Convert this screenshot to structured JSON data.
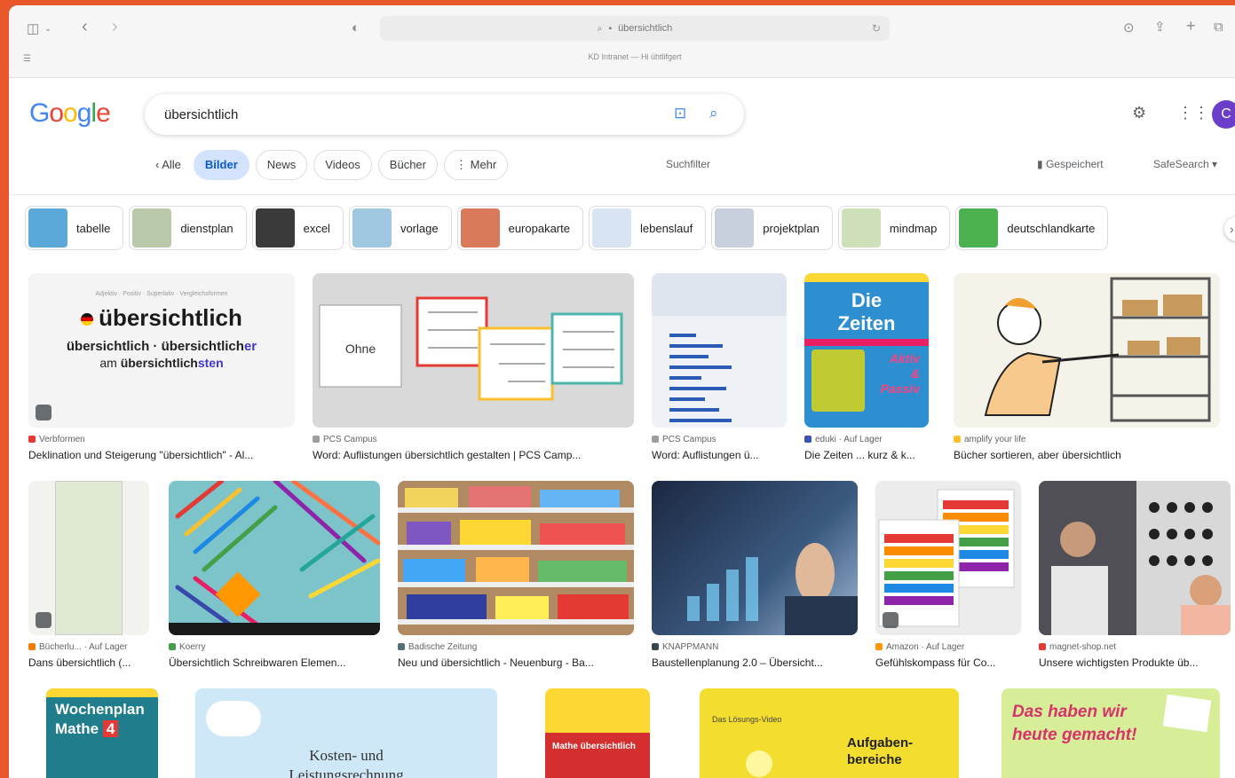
{
  "browser": {
    "url_text": "übersichtlich",
    "subtitle": "KD Intranet — Hi ühtlifgert"
  },
  "google": {
    "logo": "Google",
    "query": "übersichtlich",
    "avatar_letter": "C"
  },
  "tabs": {
    "all": "Alle",
    "images": "Bilder",
    "news": "News",
    "videos": "Videos",
    "books": "Bücher",
    "more": "Mehr",
    "search_filter": "Suchfilter",
    "saved": "Gespeichert",
    "safesearch": "SafeSearch"
  },
  "chips": [
    {
      "label": "tabelle",
      "color": "#5aa7d8"
    },
    {
      "label": "dienstplan",
      "color": "#b9c9a9"
    },
    {
      "label": "excel",
      "color": "#3a3a3a"
    },
    {
      "label": "vorlage",
      "color": "#9fc7e0"
    },
    {
      "label": "europakarte",
      "color": "#d97a5a"
    },
    {
      "label": "lebenslauf",
      "color": "#d9e4f2"
    },
    {
      "label": "projektplan",
      "color": "#c7d0dc"
    },
    {
      "label": "mindmap",
      "color": "#cde0b8"
    },
    {
      "label": "deutschlandkarte",
      "color": "#4caf50"
    }
  ],
  "results": [
    {
      "source": "Verbformen",
      "title": "Deklination und Steigerung \"übersichtlich\" - Al...",
      "color": "#f4f4f4",
      "fav": "#e53935"
    },
    {
      "source": "PCS Campus",
      "title": "Word: Auflistungen übersichtlich gestalten | PCS Camp...",
      "color": "#d6d6d6",
      "fav": "#9e9e9e"
    },
    {
      "source": "PCS Campus",
      "title": "Word: Auflistungen ü...",
      "color": "#e9eef5",
      "fav": "#9e9e9e"
    },
    {
      "source": "eduki · Auf Lager",
      "title": "Die Zeiten ... kurz & k...",
      "color": "#2d8fd0",
      "fav": "#3f51b5"
    },
    {
      "source": "amplify your life",
      "title": "Bücher sortieren, aber übersichtlich",
      "color": "#f3f0e8",
      "fav": "#fbc02d"
    },
    {
      "source": "Bücherlu... · Auf Lager",
      "title": "Dans übersichtlich (...",
      "color": "#cfe3c1",
      "fav": "#f57c00"
    },
    {
      "source": "Koerry",
      "title": "Übersichtlich Schreibwaren Elemen...",
      "color": "#7cc4c9",
      "fav": "#43a047"
    },
    {
      "source": "Badische Zeitung",
      "title": "Neu und übersichtlich - Neuenburg - Ba...",
      "color": "#9a7d5c",
      "fav": "#546e7a"
    },
    {
      "source": "KNAPPMANN",
      "title": "Baustellenplanung 2.0 – Übersicht...",
      "color": "#2a3a55",
      "fav": "#37474f"
    },
    {
      "source": "Amazon · Auf Lager",
      "title": "Gefühlskompass für Co...",
      "color": "#ececec",
      "fav": "#ff9800"
    },
    {
      "source": "magnet-shop.net",
      "title": "Unsere wichtigsten Produkte üb...",
      "color": "#6b6f77",
      "fav": "#e53935"
    }
  ],
  "first_card": {
    "meta": "Adjektiv · Positiv · Superlativ · Vergleichsformen",
    "word": "übersichtlich",
    "forms_a": "übersichtlich",
    "forms_b": "übersichtlich",
    "forms_b_suffix": "er",
    "forms_c_pre": "am ",
    "forms_c": "übersichtlich",
    "forms_c_suffix": "sten",
    "sep": " · "
  },
  "img_text": {
    "ohne": "Ohne",
    "die": "Die",
    "zeiten": "Zeiten",
    "aktiv": "Aktiv",
    "und": "&",
    "passiv": "Passiv"
  },
  "bottom": {
    "wochenplan": "Wochenplan",
    "mathe": "Mathe",
    "four": "4",
    "kosten": "Kosten- und",
    "leistung": "Leistungsrechnung",
    "mathe2": "Mathe übersichtlich",
    "aufgaben": "Aufgaben-",
    "bereiche": "bereiche",
    "lernvideo": "Das Lösungs-Video",
    "heute": "Das haben wir",
    "heute2": "heute gemacht!"
  }
}
